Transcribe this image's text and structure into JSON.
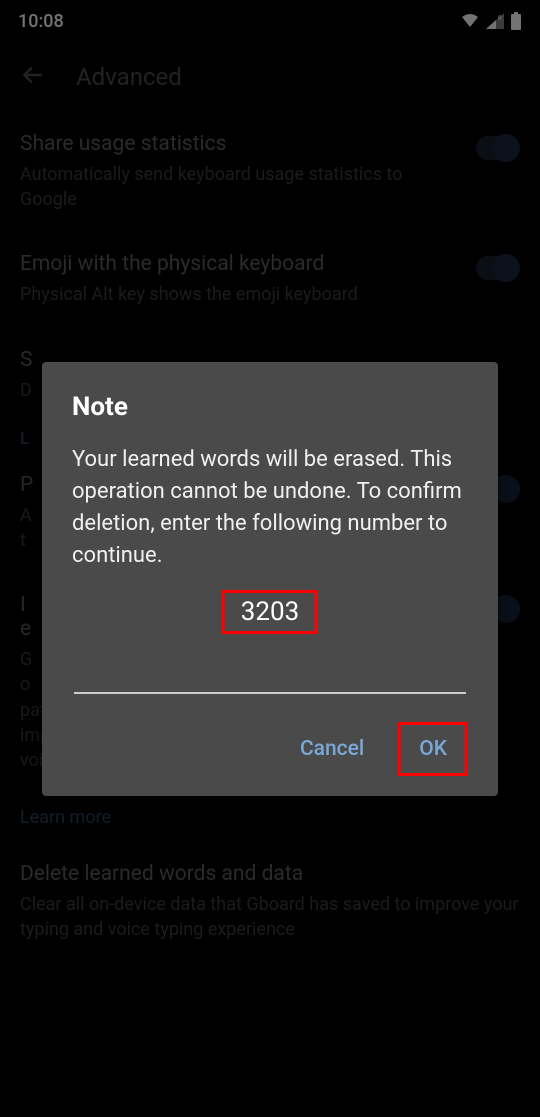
{
  "status": {
    "time": "10:08"
  },
  "header": {
    "title": "Advanced"
  },
  "settings": [
    {
      "title": "Share usage statistics",
      "desc": "Automatically send keyboard usage statistics to Google"
    },
    {
      "title": "Emoji with the physical keyboard",
      "desc": "Physical Alt key shows the emoji keyboard"
    },
    {
      "title": "S",
      "desc": "D"
    }
  ],
  "section_label": "L",
  "settings2": [
    {
      "title": "P",
      "desc": "A\nt"
    },
    {
      "title": "I\ne",
      "desc": "G\no\npatterns. With your permission, Gboard will use these improvements, in the aggregate, to update Google's voice and typing services."
    }
  ],
  "learn_more": "Learn more",
  "settings3": [
    {
      "title": "Delete learned words and data",
      "desc": "Clear all on-device data that Gboard has saved to improve your typing and voice typing experience"
    }
  ],
  "dialog": {
    "title": "Note",
    "body": "Your learned words will be erased. This operation cannot be undone. To confirm deletion, enter the following number to continue.",
    "number": "3203",
    "cancel": "Cancel",
    "ok": "OK"
  }
}
